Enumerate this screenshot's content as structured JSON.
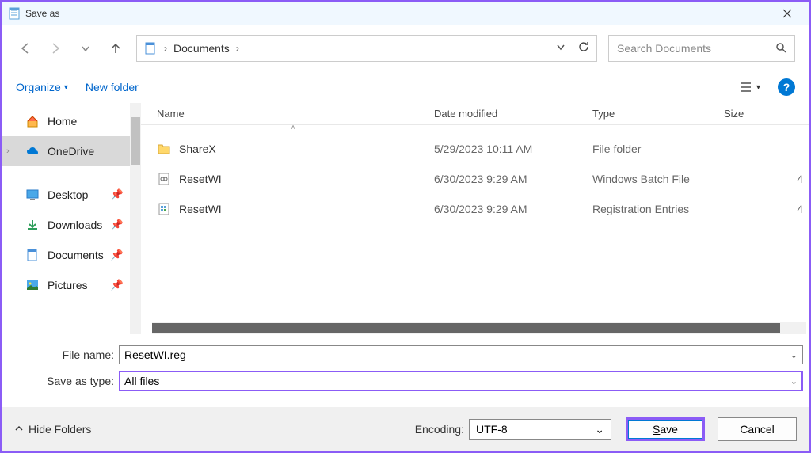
{
  "window": {
    "title": "Save as"
  },
  "nav": {
    "breadcrumb": "Documents",
    "search_placeholder": "Search Documents"
  },
  "toolbar": {
    "organize": "Organize",
    "new_folder": "New folder"
  },
  "sidebar": {
    "items": [
      {
        "label": "Home",
        "icon": "home",
        "selected": false,
        "pinned": false
      },
      {
        "label": "OneDrive",
        "icon": "onedrive",
        "selected": true,
        "pinned": false,
        "expandable": true
      },
      {
        "label": "Desktop",
        "icon": "desktop",
        "selected": false,
        "pinned": true
      },
      {
        "label": "Downloads",
        "icon": "downloads",
        "selected": false,
        "pinned": true
      },
      {
        "label": "Documents",
        "icon": "documents",
        "selected": false,
        "pinned": true
      },
      {
        "label": "Pictures",
        "icon": "pictures",
        "selected": false,
        "pinned": true
      }
    ]
  },
  "filelist": {
    "headers": {
      "name": "Name",
      "date": "Date modified",
      "type": "Type",
      "size": "Size"
    },
    "rows": [
      {
        "name": "ShareX",
        "date": "5/29/2023 10:11 AM",
        "type": "File folder",
        "size": "",
        "icon": "folder"
      },
      {
        "name": "ResetWI",
        "date": "6/30/2023 9:29 AM",
        "type": "Windows Batch File",
        "size": "4",
        "icon": "batch"
      },
      {
        "name": "ResetWI",
        "date": "6/30/2023 9:29 AM",
        "type": "Registration Entries",
        "size": "4",
        "icon": "reg"
      }
    ]
  },
  "form": {
    "filename_label": "File name:",
    "filename_value": "ResetWI.reg",
    "type_label": "Save as type:",
    "type_value": "All files"
  },
  "footer": {
    "hide_folders": "Hide Folders",
    "encoding_label": "Encoding:",
    "encoding_value": "UTF-8",
    "save": "Save",
    "cancel": "Cancel"
  }
}
